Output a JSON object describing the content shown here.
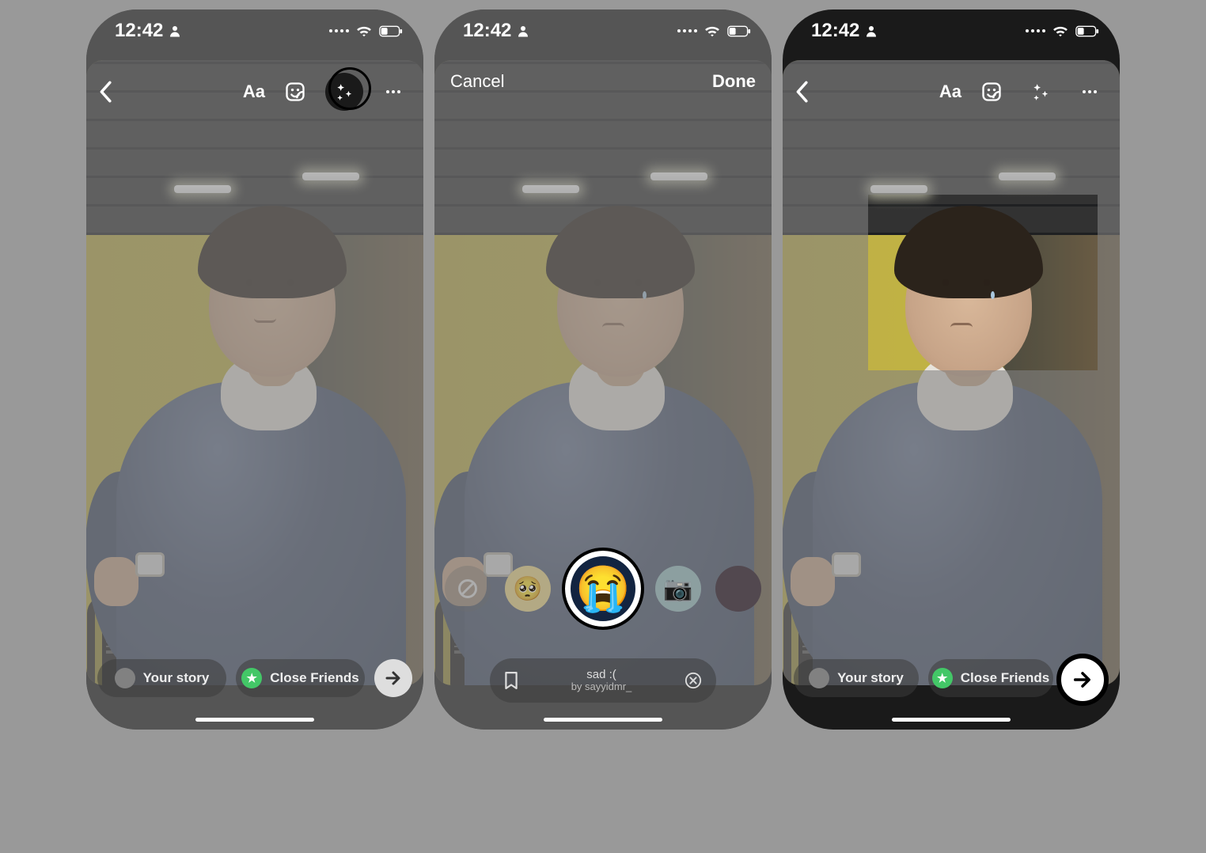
{
  "status": {
    "time": "12:42",
    "wifi_strength": 3,
    "battery_level_pct": 35
  },
  "screen1": {
    "toolbar": {
      "text_label": "Aa"
    },
    "share": {
      "your_story": "Your story",
      "close_friends": "Close Friends"
    }
  },
  "screen2": {
    "cancel": "Cancel",
    "done": "Done",
    "filter": {
      "name": "sad :(",
      "by_prefix": "by ",
      "author": "sayyidmr_"
    },
    "filter_reel": {
      "selected_icon": "crying-face",
      "items": [
        "none",
        "pleading-face",
        "crying-face",
        "film-camera",
        "gallery"
      ]
    }
  },
  "screen3": {
    "toolbar": {
      "text_label": "Aa"
    },
    "share": {
      "your_story": "Your story",
      "close_friends": "Close Friends"
    }
  }
}
